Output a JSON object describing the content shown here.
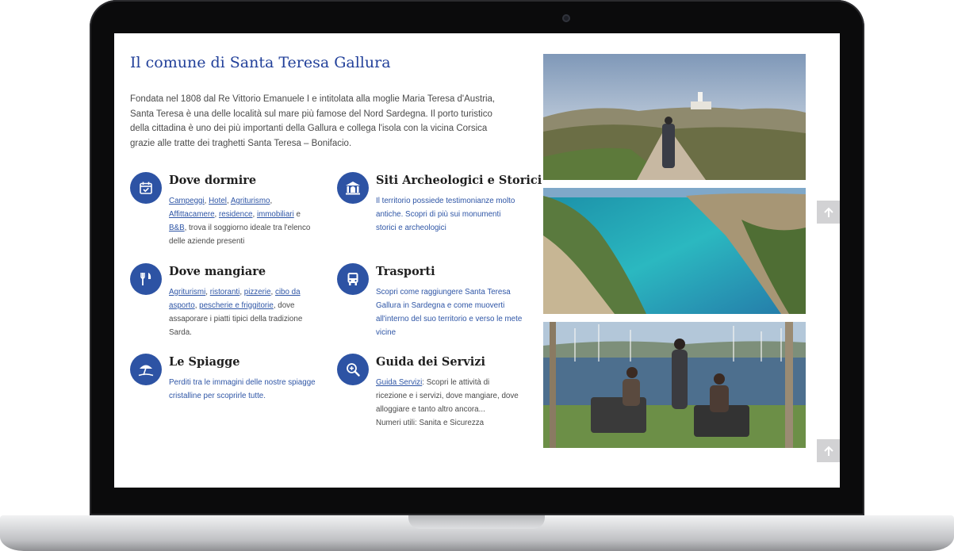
{
  "page": {
    "title": "Il comune di Santa Teresa Gallura",
    "intro": "Fondata nel 1808 dal Re Vittorio Emanuele I e intitolata alla moglie Maria Teresa d'Austria, Santa Teresa è una delle località sul mare più famose del Nord Sardegna. Il porto turistico della cittadina è uno dei più importanti della Gallura e collega l'isola con la vicina Corsica grazie alle tratte dei traghetti Santa Teresa – Bonifacio."
  },
  "colors": {
    "accent": "#2d53a4",
    "title": "#22409a",
    "link": "#2f56a6"
  },
  "features": {
    "dormire": {
      "icon": "calendar-check-icon",
      "title": "Dove dormire",
      "links": [
        "Campeggi",
        "Hotel",
        "Agriturismo",
        "Affittacamere",
        "residence",
        "immobiliari",
        "B&B"
      ],
      "sep_e": "e",
      "rest": ", trova il soggiorno ideale tra l'elenco delle aziende presenti"
    },
    "siti": {
      "icon": "monument-icon",
      "title": "Siti Archeologici e Storici",
      "text": "Il territorio possiede testimonianze molto antiche. Scopri di più sui monumenti storici e archeologici"
    },
    "mangiare": {
      "icon": "fork-knife-icon",
      "title": "Dove mangiare",
      "links": [
        "Agriturismi",
        "ristoranti",
        "pizzerie",
        "cibo da asporto",
        "pescherie e friggitorie"
      ],
      "rest": ", dove assaporare i piatti tipici della tradizione Sarda."
    },
    "trasporti": {
      "icon": "bus-icon",
      "title": "Trasporti",
      "text": "Scopri come raggiungere Santa Teresa Gallura in Sardegna e come muoverti all'interno del suo territorio e verso le mete vicine"
    },
    "spiagge": {
      "icon": "beach-umbrella-icon",
      "title": "Le Spiagge",
      "text": "Perditi tra le immagini delle nostre spiagge cristalline per scoprirle tutte."
    },
    "servizi": {
      "icon": "search-zoom-icon",
      "title": "Guida dei Servizi",
      "link": "Guida Servizi",
      "text": ": Scopri le attività di ricezione e i servizi, dove mangiare, dove alloggiare e tanto altro ancora...",
      "extra": "Numeri utili: Sanita e Sicurezza"
    }
  },
  "photos": [
    "lighthouse-path-photo",
    "turquoise-cove-photo",
    "harbor-cafe-photo"
  ],
  "scroll_buttons": [
    "arrow-up-icon",
    "arrow-up-icon"
  ]
}
